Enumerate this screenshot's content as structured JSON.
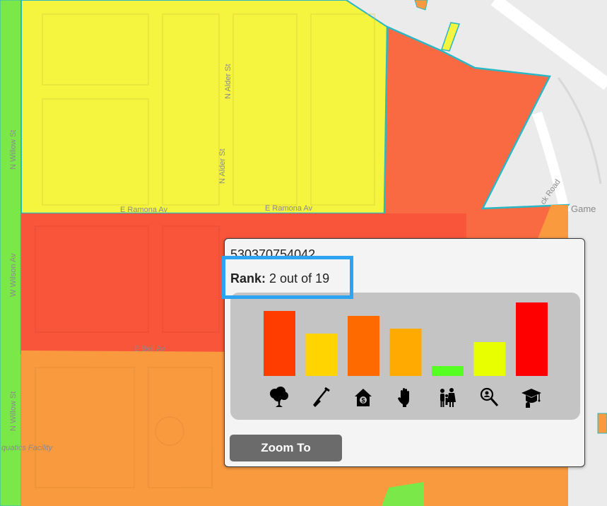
{
  "map": {
    "street_labels": {
      "alder1": "N Alder St",
      "alder2": "N Alder St",
      "game": "Game",
      "gack": "ck Road",
      "aquatics": "quatics Facility",
      "west1": "N Willow St",
      "west2": "W Wilson Av",
      "west3": "N Willow St",
      "mid1": "E Ramona Av",
      "mid2": "E Ramona Av",
      "mid3": "E Bell Av"
    },
    "colors": {
      "yellow": "#f5f53f",
      "red": "#f8553b",
      "orange_red": "#fa6a42",
      "orange": "#f99a3f",
      "green": "#7be84a",
      "outline": "#2bb7c4"
    }
  },
  "popup": {
    "id_text": "530370754042",
    "rank_label": "Rank:",
    "rank_value": "2 out of 19",
    "zoom_button": "Zoom To"
  },
  "chart_data": {
    "type": "bar",
    "categories": [
      "tree-icon",
      "shovel-icon",
      "house-dollar-icon",
      "hand-icon",
      "family-icon",
      "search-person-icon",
      "graduation-icon"
    ],
    "values": [
      92,
      60,
      85,
      67,
      14,
      48,
      104
    ],
    "colors": [
      "#ff3d00",
      "#ffd400",
      "#ff6a00",
      "#ffaa00",
      "#55ff22",
      "#e8ff00",
      "#ff0000"
    ],
    "ylim": [
      0,
      110
    ]
  }
}
